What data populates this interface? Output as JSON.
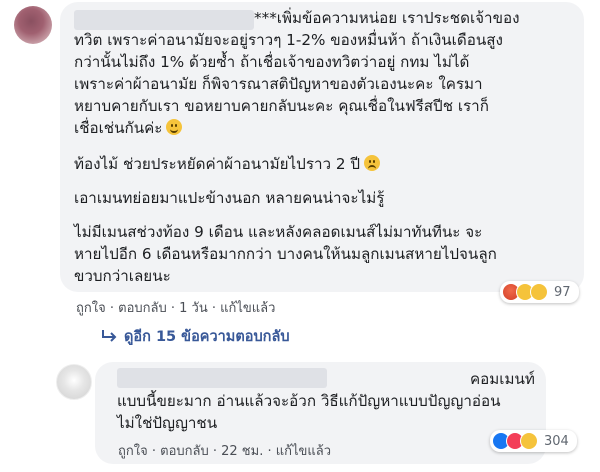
{
  "comment1": {
    "prefix": "***",
    "lines": [
      "เพิ่มข้อความหน่อย เราประชดเจ้าของ",
      "ทวิต เพราะค่าอนามัยจะอยู่ราวๆ 1-2% ของหมื่นห้า ถ้าเงินเดือนสูง",
      "กว่านั้นไม่ถึง 1% ด้วยซ้ำ ถ้าเชื่อเจ้าของทวิตว่าอยู่ กทม ไม่ได้",
      "เพราะค่าผ้าอนามัย ก็พิจารณาสติปัญหาของตัวเองนะคะ ใครมา",
      "หยาบคายกับเรา ขอหยาบคายกลับนะคะ คุณเชื่อในฟรีสปีช เราก็",
      "เชื่อเช่นกันค่ะ"
    ],
    "para2": "ท้องไม้ ช่วยประหยัดค่าผ้าอนามัยไปราว 2 ปี",
    "para3": "เอาเมนทย่อยมาแปะข้างนอก หลายคนน่าจะไม่รู้",
    "para4": [
      "ไม่มีเมนสช่วงท้อง 9 เดือน และหลังคลอดเมนส์ไม่มาทันทีนะ จะ",
      "หายไปอีก 6 เดือนหรือมากกว่า บางคนให้นมลูกเมนสหายไปจนลูก",
      "ขวบกว่าเลยนะ"
    ],
    "actions": {
      "like": "ถูกใจ",
      "reply": "ตอบกลับ",
      "time": "1 วัน",
      "edited": "แก้ไขแล้ว",
      "sep": " · "
    },
    "reaction_count": "97",
    "reaction_icons": [
      "angry",
      "sad",
      "haha"
    ]
  },
  "view_replies": "ดูอีก 15 ข้อความตอบกลับ",
  "comment2": {
    "lines": [
      "คอมเมนท์",
      "แบบนี้ขยะมาก อ่านแล้วจะอ้วก วิธีแก้ปัญหาแบบปัญญาอ่อน",
      "ไม่ใช่ปัญญาชน"
    ],
    "actions": {
      "like": "ถูกใจ",
      "reply": "ตอบกลับ",
      "time": "22 ชม.",
      "edited": "แก้ไขแล้ว",
      "sep": " · "
    },
    "reaction_count": "304",
    "reaction_icons": [
      "like",
      "love",
      "haha"
    ]
  }
}
